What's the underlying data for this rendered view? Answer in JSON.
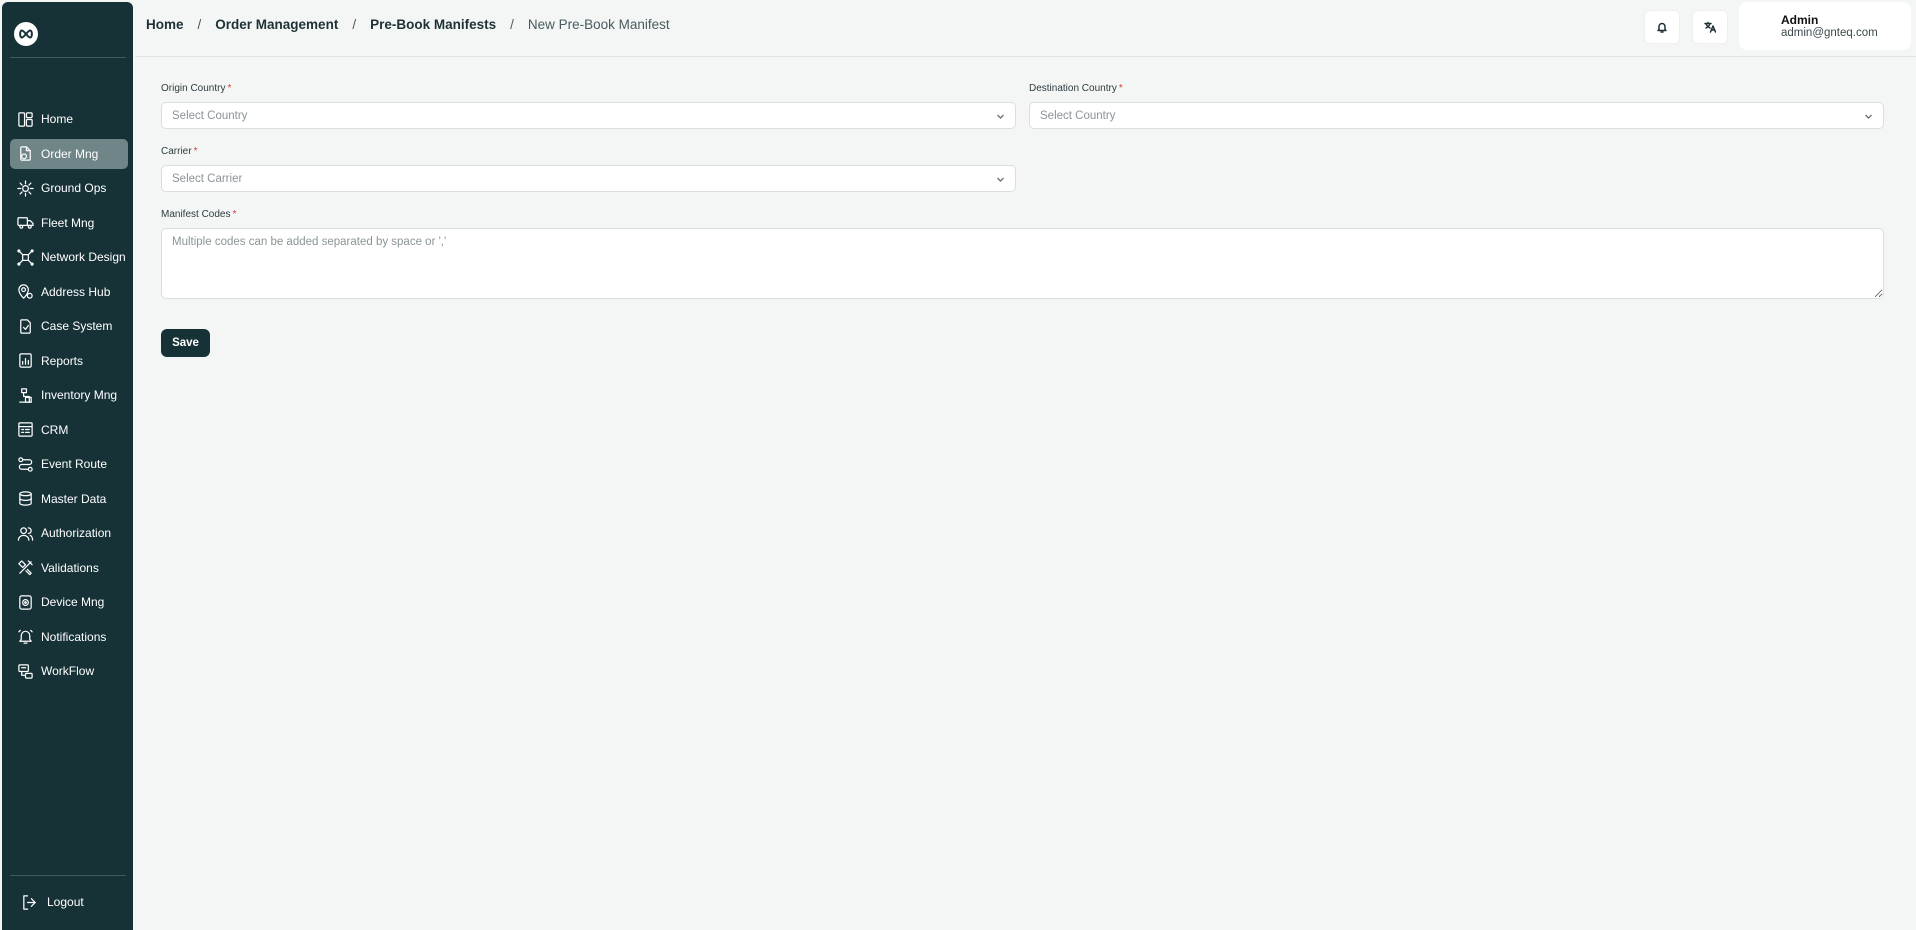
{
  "sidebar": {
    "items": [
      {
        "label": "Home",
        "icon": "dashboard-icon"
      },
      {
        "label": "Order Mng",
        "icon": "order-icon",
        "active": true
      },
      {
        "label": "Ground Ops",
        "icon": "ground-ops-icon"
      },
      {
        "label": "Fleet Mng",
        "icon": "truck-icon"
      },
      {
        "label": "Network Design",
        "icon": "network-icon"
      },
      {
        "label": "Address Hub",
        "icon": "map-pin-icon"
      },
      {
        "label": "Case System",
        "icon": "case-icon"
      },
      {
        "label": "Reports",
        "icon": "report-icon"
      },
      {
        "label": "Inventory Mng",
        "icon": "inventory-icon"
      },
      {
        "label": "CRM",
        "icon": "crm-icon"
      },
      {
        "label": "Event Route",
        "icon": "route-icon"
      },
      {
        "label": "Master Data",
        "icon": "database-icon"
      },
      {
        "label": "Authorization",
        "icon": "users-icon"
      },
      {
        "label": "Validations",
        "icon": "tools-icon"
      },
      {
        "label": "Device Mng",
        "icon": "device-icon"
      },
      {
        "label": "Notifications",
        "icon": "bell-icon"
      },
      {
        "label": "WorkFlow",
        "icon": "workflow-icon"
      }
    ],
    "logout_label": "Logout"
  },
  "header": {
    "breadcrumb": {
      "home": "Home",
      "order_management": "Order Management",
      "pre_book_manifests": "Pre-Book Manifests",
      "current": "New Pre-Book Manifest",
      "separator": "/"
    },
    "user": {
      "name": "Admin",
      "email": "admin@gnteq.com"
    }
  },
  "form": {
    "origin_country": {
      "label": "Origin Country",
      "placeholder": "Select Country"
    },
    "destination_country": {
      "label": "Destination Country",
      "placeholder": "Select Country"
    },
    "carrier": {
      "label": "Carrier",
      "placeholder": "Select Carrier"
    },
    "manifest_codes": {
      "label": "Manifest Codes",
      "placeholder": "Multiple codes can be added separated by space or ','"
    },
    "required_mark": "*",
    "save_label": "Save"
  },
  "colors": {
    "sidebar_bg": "#163237",
    "active_item_bg": "#6f8587",
    "page_bg": "#f4f6f5",
    "required": "#d23b3b"
  }
}
